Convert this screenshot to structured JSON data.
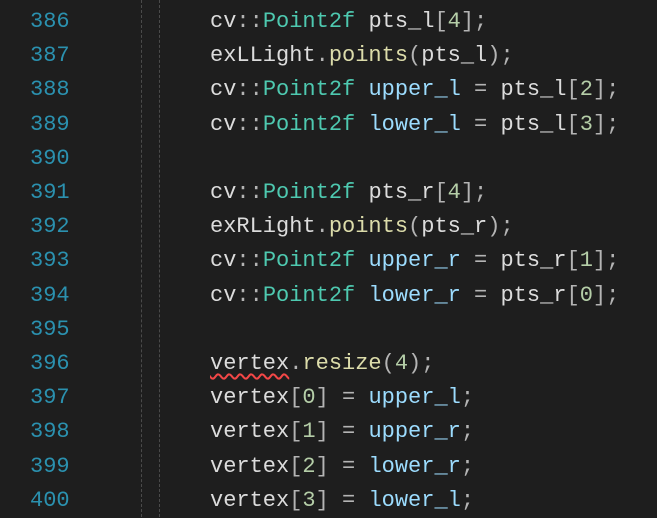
{
  "editor": {
    "line_numbers": [
      "386",
      "387",
      "388",
      "389",
      "390",
      "391",
      "392",
      "393",
      "394",
      "395",
      "396",
      "397",
      "398",
      "399",
      "400"
    ],
    "colors": {
      "background": "#1e1e1e",
      "line_number": "#2b91af",
      "type": "#4ec9b0",
      "variable": "#9cdcfe",
      "function": "#dcdcaa",
      "number": "#b5cea8",
      "error_squiggle": "#f44747"
    },
    "lines": [
      {
        "tokens": [
          {
            "t": "cv",
            "c": "ns"
          },
          {
            "t": "::",
            "c": "punct"
          },
          {
            "t": "Point2f",
            "c": "type"
          },
          {
            "t": " ",
            "c": "local"
          },
          {
            "t": "pts_l",
            "c": "local"
          },
          {
            "t": "[",
            "c": "punct"
          },
          {
            "t": "4",
            "c": "num"
          },
          {
            "t": "];",
            "c": "punct"
          }
        ]
      },
      {
        "tokens": [
          {
            "t": "exLLight",
            "c": "local"
          },
          {
            "t": ".",
            "c": "punct"
          },
          {
            "t": "points",
            "c": "fn"
          },
          {
            "t": "(",
            "c": "punct"
          },
          {
            "t": "pts_l",
            "c": "local"
          },
          {
            "t": ");",
            "c": "punct"
          }
        ]
      },
      {
        "tokens": [
          {
            "t": "cv",
            "c": "ns"
          },
          {
            "t": "::",
            "c": "punct"
          },
          {
            "t": "Point2f",
            "c": "type"
          },
          {
            "t": " ",
            "c": "local"
          },
          {
            "t": "upper_l",
            "c": "var"
          },
          {
            "t": " = ",
            "c": "punct"
          },
          {
            "t": "pts_l",
            "c": "local"
          },
          {
            "t": "[",
            "c": "punct"
          },
          {
            "t": "2",
            "c": "num"
          },
          {
            "t": "];",
            "c": "punct"
          }
        ]
      },
      {
        "tokens": [
          {
            "t": "cv",
            "c": "ns"
          },
          {
            "t": "::",
            "c": "punct"
          },
          {
            "t": "Point2f",
            "c": "type"
          },
          {
            "t": " ",
            "c": "local"
          },
          {
            "t": "lower_l",
            "c": "var"
          },
          {
            "t": " = ",
            "c": "punct"
          },
          {
            "t": "pts_l",
            "c": "local"
          },
          {
            "t": "[",
            "c": "punct"
          },
          {
            "t": "3",
            "c": "num"
          },
          {
            "t": "];",
            "c": "punct"
          }
        ]
      },
      {
        "tokens": []
      },
      {
        "tokens": [
          {
            "t": "cv",
            "c": "ns"
          },
          {
            "t": "::",
            "c": "punct"
          },
          {
            "t": "Point2f",
            "c": "type"
          },
          {
            "t": " ",
            "c": "local"
          },
          {
            "t": "pts_r",
            "c": "local"
          },
          {
            "t": "[",
            "c": "punct"
          },
          {
            "t": "4",
            "c": "num"
          },
          {
            "t": "];",
            "c": "punct"
          }
        ]
      },
      {
        "tokens": [
          {
            "t": "exRLight",
            "c": "local"
          },
          {
            "t": ".",
            "c": "punct"
          },
          {
            "t": "points",
            "c": "fn"
          },
          {
            "t": "(",
            "c": "punct"
          },
          {
            "t": "pts_r",
            "c": "local"
          },
          {
            "t": ");",
            "c": "punct"
          }
        ]
      },
      {
        "tokens": [
          {
            "t": "cv",
            "c": "ns"
          },
          {
            "t": "::",
            "c": "punct"
          },
          {
            "t": "Point2f",
            "c": "type"
          },
          {
            "t": " ",
            "c": "local"
          },
          {
            "t": "upper_r",
            "c": "var"
          },
          {
            "t": " = ",
            "c": "punct"
          },
          {
            "t": "pts_r",
            "c": "local"
          },
          {
            "t": "[",
            "c": "punct"
          },
          {
            "t": "1",
            "c": "num"
          },
          {
            "t": "];",
            "c": "punct"
          }
        ]
      },
      {
        "tokens": [
          {
            "t": "cv",
            "c": "ns"
          },
          {
            "t": "::",
            "c": "punct"
          },
          {
            "t": "Point2f",
            "c": "type"
          },
          {
            "t": " ",
            "c": "local"
          },
          {
            "t": "lower_r",
            "c": "var"
          },
          {
            "t": " = ",
            "c": "punct"
          },
          {
            "t": "pts_r",
            "c": "local"
          },
          {
            "t": "[",
            "c": "punct"
          },
          {
            "t": "0",
            "c": "num"
          },
          {
            "t": "];",
            "c": "punct"
          }
        ]
      },
      {
        "tokens": []
      },
      {
        "tokens": [
          {
            "t": "vertex",
            "c": "local",
            "error": true
          },
          {
            "t": ".",
            "c": "punct"
          },
          {
            "t": "resize",
            "c": "fn"
          },
          {
            "t": "(",
            "c": "punct"
          },
          {
            "t": "4",
            "c": "num"
          },
          {
            "t": ");",
            "c": "punct"
          }
        ]
      },
      {
        "tokens": [
          {
            "t": "vertex",
            "c": "local"
          },
          {
            "t": "[",
            "c": "punct"
          },
          {
            "t": "0",
            "c": "num"
          },
          {
            "t": "] = ",
            "c": "punct"
          },
          {
            "t": "upper_l",
            "c": "var"
          },
          {
            "t": ";",
            "c": "punct"
          }
        ]
      },
      {
        "tokens": [
          {
            "t": "vertex",
            "c": "local"
          },
          {
            "t": "[",
            "c": "punct"
          },
          {
            "t": "1",
            "c": "num"
          },
          {
            "t": "] = ",
            "c": "punct"
          },
          {
            "t": "upper_r",
            "c": "var"
          },
          {
            "t": ";",
            "c": "punct"
          }
        ]
      },
      {
        "tokens": [
          {
            "t": "vertex",
            "c": "local"
          },
          {
            "t": "[",
            "c": "punct"
          },
          {
            "t": "2",
            "c": "num"
          },
          {
            "t": "] = ",
            "c": "punct"
          },
          {
            "t": "lower_r",
            "c": "var"
          },
          {
            "t": ";",
            "c": "punct"
          }
        ]
      },
      {
        "tokens": [
          {
            "t": "vertex",
            "c": "local"
          },
          {
            "t": "[",
            "c": "punct"
          },
          {
            "t": "3",
            "c": "num"
          },
          {
            "t": "] = ",
            "c": "punct"
          },
          {
            "t": "lower_l",
            "c": "var"
          },
          {
            "t": ";",
            "c": "punct"
          }
        ]
      }
    ]
  }
}
